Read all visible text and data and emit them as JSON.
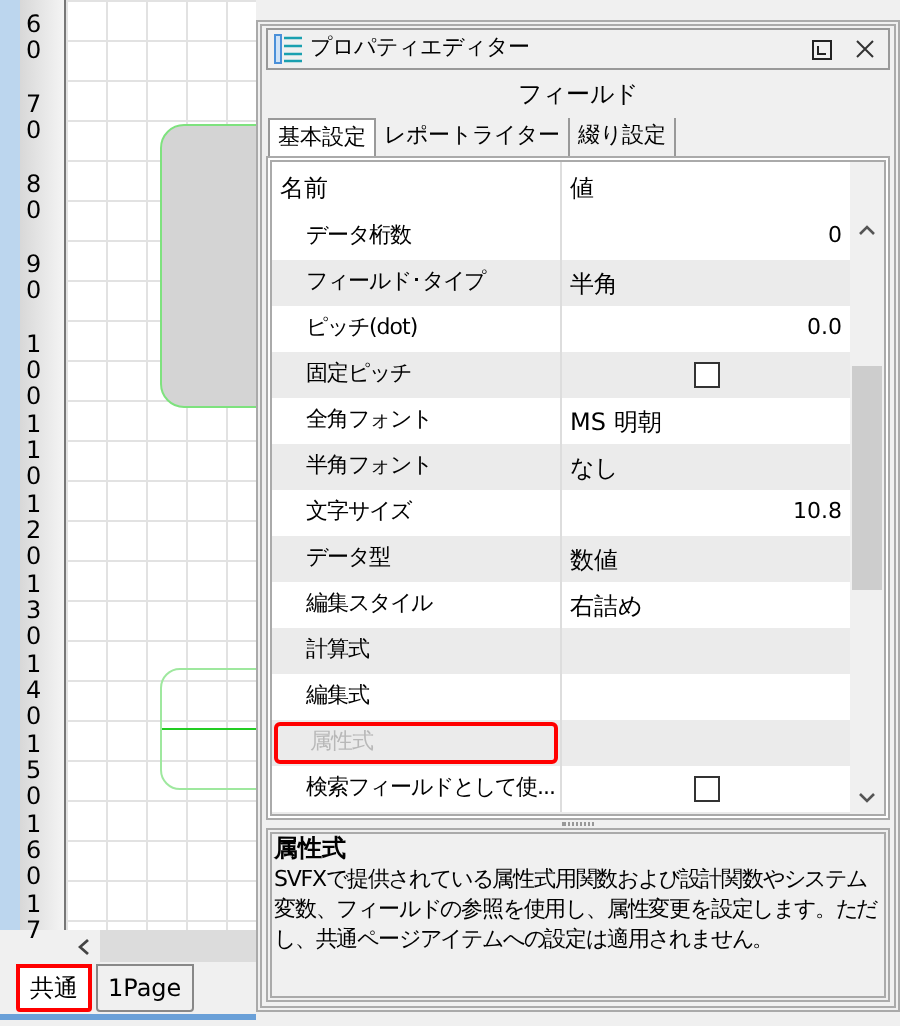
{
  "ruler": {
    "labels": [
      "60",
      "70",
      "80",
      "90",
      "100",
      "110",
      "120",
      "130",
      "140",
      "150",
      "160",
      "17"
    ]
  },
  "sheet_tabs": [
    {
      "label": "共通",
      "selected": true,
      "highlighted": true
    },
    {
      "label": "1Page",
      "selected": false,
      "highlighted": false
    }
  ],
  "property_editor": {
    "title": "プロパティエディター",
    "heading": "フィールド",
    "tabs": [
      {
        "label": "基本設定",
        "selected": true
      },
      {
        "label": "レポートライター",
        "selected": false
      },
      {
        "label": "綴り設定",
        "selected": false
      }
    ],
    "columns": [
      "名前",
      "値"
    ],
    "rows": [
      {
        "name": "データ桁数",
        "kind": "number",
        "value": "0"
      },
      {
        "name": "フィールド･タイプ",
        "kind": "text",
        "value": "半角"
      },
      {
        "name": "ピッチ(dot)",
        "kind": "number",
        "value": "0.0"
      },
      {
        "name": "固定ピッチ",
        "kind": "checkbox",
        "checked": false
      },
      {
        "name": "全角フォント",
        "kind": "text",
        "value": "MS 明朝"
      },
      {
        "name": "半角フォント",
        "kind": "text",
        "value": "なし"
      },
      {
        "name": "文字サイズ",
        "kind": "number",
        "value": "10.8"
      },
      {
        "name": "データ型",
        "kind": "text",
        "value": "数値"
      },
      {
        "name": "編集スタイル",
        "kind": "text",
        "value": "右詰め"
      },
      {
        "name": "計算式",
        "kind": "empty"
      },
      {
        "name": "編集式",
        "kind": "empty"
      },
      {
        "name": "属性式",
        "kind": "empty",
        "disabled": true,
        "highlighted": true
      },
      {
        "name": "検索フィールドとして使...",
        "kind": "checkbox",
        "checked": false
      }
    ],
    "description": {
      "title": "属性式",
      "text": "SVFXで提供されている属性式用関数および設計関数やシステム変数、フィールドの参照を使用し、属性変更を設定します。ただし、共通ページアイテムへの設定は適用されません。"
    }
  }
}
